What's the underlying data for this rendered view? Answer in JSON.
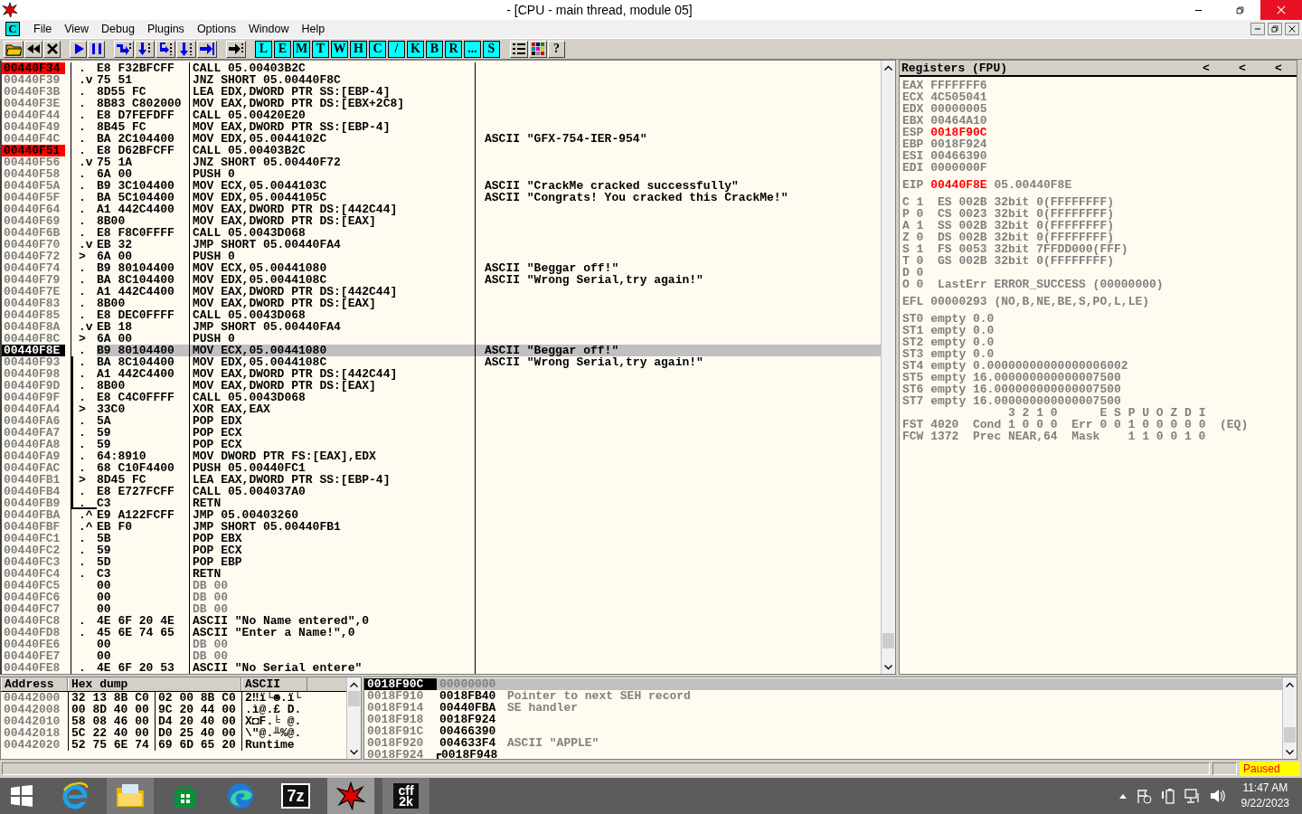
{
  "window": {
    "title": "- [CPU - main thread, module 05]"
  },
  "menu": {
    "badge": "C",
    "items": [
      "File",
      "View",
      "Debug",
      "Plugins",
      "Options",
      "Window",
      "Help"
    ]
  },
  "toolbar": [
    {
      "items": [
        {
          "kind": "open"
        },
        {
          "kind": "restart"
        },
        {
          "kind": "close"
        }
      ]
    },
    {
      "items": [
        {
          "kind": "run"
        },
        {
          "kind": "pause"
        }
      ]
    },
    {
      "items": [
        {
          "kind": "step-into"
        },
        {
          "kind": "step-over"
        },
        {
          "kind": "trace-into"
        },
        {
          "kind": "trace-over"
        },
        {
          "kind": "till-return"
        }
      ]
    },
    {
      "items": [
        {
          "kind": "goto"
        }
      ]
    },
    {
      "items": [
        {
          "kind": "window",
          "label": "L"
        },
        {
          "kind": "window",
          "label": "E"
        },
        {
          "kind": "window",
          "label": "M"
        },
        {
          "kind": "window",
          "label": "T"
        },
        {
          "kind": "window",
          "label": "W"
        },
        {
          "kind": "window",
          "label": "H"
        },
        {
          "kind": "window",
          "label": "C"
        },
        {
          "kind": "window",
          "label": "/"
        },
        {
          "kind": "window",
          "label": "K"
        },
        {
          "kind": "window",
          "label": "B"
        },
        {
          "kind": "window",
          "label": "R"
        },
        {
          "kind": "window",
          "label": "..."
        },
        {
          "kind": "window",
          "label": "S"
        }
      ]
    },
    {
      "items": [
        {
          "kind": "list"
        },
        {
          "kind": "colors"
        },
        {
          "kind": "help",
          "label": "?"
        }
      ]
    }
  ],
  "disassembly": {
    "rows": [
      {
        "address": "00440F34",
        "mark": ".",
        "hex": "E8 F32BFCFF",
        "command": "CALL 05.00403B2C",
        "breakpoint": true,
        "selected": false,
        "greyed": false,
        "bracketed": false
      },
      {
        "address": "00440F39",
        "mark": ".v",
        "hex": "75 51",
        "command": "JNZ SHORT 05.00440F8C",
        "breakpoint": false,
        "selected": false,
        "greyed": false,
        "bracketed": false
      },
      {
        "address": "00440F3B",
        "mark": ".",
        "hex": "8D55 FC",
        "command": "LEA EDX,DWORD PTR SS:[EBP-4]",
        "breakpoint": false,
        "selected": false,
        "greyed": false,
        "bracketed": false
      },
      {
        "address": "00440F3E",
        "mark": ".",
        "hex": "8B83 C802000",
        "command": "MOV EAX,DWORD PTR DS:[EBX+2C8]",
        "breakpoint": false,
        "selected": false,
        "greyed": false,
        "bracketed": false
      },
      {
        "address": "00440F44",
        "mark": ".",
        "hex": "E8 D7FEFDFF",
        "command": "CALL 05.00420E20",
        "breakpoint": false,
        "selected": false,
        "greyed": false,
        "bracketed": false
      },
      {
        "address": "00440F49",
        "mark": ".",
        "hex": "8B45 FC",
        "command": "MOV EAX,DWORD PTR SS:[EBP-4]",
        "breakpoint": false,
        "selected": false,
        "greyed": false,
        "bracketed": false
      },
      {
        "address": "00440F4C",
        "mark": ".",
        "hex": "BA 2C104400",
        "command": "MOV EDX,05.0044102C",
        "comment": "ASCII \"GFX-754-IER-954\"",
        "breakpoint": false,
        "selected": false,
        "greyed": false,
        "bracketed": false
      },
      {
        "address": "00440F51",
        "mark": ".",
        "hex": "E8 D62BFCFF",
        "command": "CALL 05.00403B2C",
        "breakpoint": true,
        "selected": false,
        "greyed": false,
        "bracketed": false
      },
      {
        "address": "00440F56",
        "mark": ".v",
        "hex": "75 1A",
        "command": "JNZ SHORT 05.00440F72",
        "breakpoint": false,
        "selected": false,
        "greyed": false,
        "bracketed": false
      },
      {
        "address": "00440F58",
        "mark": ".",
        "hex": "6A 00",
        "command": "PUSH 0",
        "breakpoint": false,
        "selected": false,
        "greyed": false,
        "bracketed": false
      },
      {
        "address": "00440F5A",
        "mark": ".",
        "hex": "B9 3C104400",
        "command": "MOV ECX,05.0044103C",
        "comment": "ASCII \"CrackMe cracked successfully\"",
        "breakpoint": false,
        "selected": false,
        "greyed": false,
        "bracketed": false
      },
      {
        "address": "00440F5F",
        "mark": ".",
        "hex": "BA 5C104400",
        "command": "MOV EDX,05.0044105C",
        "comment": "ASCII \"Congrats! You cracked this CrackMe!\"",
        "breakpoint": false,
        "selected": false,
        "greyed": false,
        "bracketed": false
      },
      {
        "address": "00440F64",
        "mark": ".",
        "hex": "A1 442C4400",
        "command": "MOV EAX,DWORD PTR DS:[442C44]",
        "breakpoint": false,
        "selected": false,
        "greyed": false,
        "bracketed": false
      },
      {
        "address": "00440F69",
        "mark": ".",
        "hex": "8B00",
        "command": "MOV EAX,DWORD PTR DS:[EAX]",
        "breakpoint": false,
        "selected": false,
        "greyed": false,
        "bracketed": false
      },
      {
        "address": "00440F6B",
        "mark": ".",
        "hex": "E8 F8C0FFFF",
        "command": "CALL 05.0043D068",
        "breakpoint": false,
        "selected": false,
        "greyed": false,
        "bracketed": false
      },
      {
        "address": "00440F70",
        "mark": ".v",
        "hex": "EB 32",
        "command": "JMP SHORT 05.00440FA4",
        "breakpoint": false,
        "selected": false,
        "greyed": false,
        "bracketed": false
      },
      {
        "address": "00440F72",
        "mark": ">",
        "hex": "6A 00",
        "command": "PUSH 0",
        "breakpoint": false,
        "selected": false,
        "greyed": false,
        "bracketed": false
      },
      {
        "address": "00440F74",
        "mark": ".",
        "hex": "B9 80104400",
        "command": "MOV ECX,05.00441080",
        "comment": "ASCII \"Beggar off!\"",
        "breakpoint": false,
        "selected": false,
        "greyed": false,
        "bracketed": false
      },
      {
        "address": "00440F79",
        "mark": ".",
        "hex": "BA 8C104400",
        "command": "MOV EDX,05.0044108C",
        "comment": "ASCII \"Wrong Serial,try again!\"",
        "breakpoint": false,
        "selected": false,
        "greyed": false,
        "bracketed": false
      },
      {
        "address": "00440F7E",
        "mark": ".",
        "hex": "A1 442C4400",
        "command": "MOV EAX,DWORD PTR DS:[442C44]",
        "breakpoint": false,
        "selected": false,
        "greyed": false,
        "bracketed": false
      },
      {
        "address": "00440F83",
        "mark": ".",
        "hex": "8B00",
        "command": "MOV EAX,DWORD PTR DS:[EAX]",
        "breakpoint": false,
        "selected": false,
        "greyed": false,
        "bracketed": false
      },
      {
        "address": "00440F85",
        "mark": ".",
        "hex": "E8 DEC0FFFF",
        "command": "CALL 05.0043D068",
        "breakpoint": false,
        "selected": false,
        "greyed": false,
        "bracketed": false
      },
      {
        "address": "00440F8A",
        "mark": ".v",
        "hex": "EB 18",
        "command": "JMP SHORT 05.00440FA4",
        "breakpoint": false,
        "selected": false,
        "greyed": false,
        "bracketed": false
      },
      {
        "address": "00440F8C",
        "mark": ">",
        "hex": "6A 00",
        "command": "PUSH 0",
        "breakpoint": false,
        "selected": false,
        "greyed": false,
        "bracketed": false
      },
      {
        "address": "00440F8E",
        "mark": ".",
        "hex": "B9 80104400",
        "command": "MOV ECX,05.00441080",
        "comment": "ASCII \"Beggar off!\"",
        "breakpoint": false,
        "selected": true,
        "greyed": false,
        "bracketed": false
      },
      {
        "address": "00440F93",
        "mark": ".",
        "hex": "BA 8C104400",
        "command": "MOV EDX,05.0044108C",
        "comment": "ASCII \"Wrong Serial,try again!\"",
        "breakpoint": false,
        "selected": false,
        "greyed": false,
        "bracketed": true
      },
      {
        "address": "00440F98",
        "mark": ".",
        "hex": "A1 442C4400",
        "command": "MOV EAX,DWORD PTR DS:[442C44]",
        "breakpoint": false,
        "selected": false,
        "greyed": false,
        "bracketed": true
      },
      {
        "address": "00440F9D",
        "mark": ".",
        "hex": "8B00",
        "command": "MOV EAX,DWORD PTR DS:[EAX]",
        "breakpoint": false,
        "selected": false,
        "greyed": false,
        "bracketed": true
      },
      {
        "address": "00440F9F",
        "mark": ".",
        "hex": "E8 C4C0FFFF",
        "command": "CALL 05.0043D068",
        "breakpoint": false,
        "selected": false,
        "greyed": false,
        "bracketed": true
      },
      {
        "address": "00440FA4",
        "mark": ">",
        "hex": "33C0",
        "command": "XOR EAX,EAX",
        "breakpoint": false,
        "selected": false,
        "greyed": false,
        "bracketed": true
      },
      {
        "address": "00440FA6",
        "mark": ".",
        "hex": "5A",
        "command": "POP EDX",
        "breakpoint": false,
        "selected": false,
        "greyed": false,
        "bracketed": true
      },
      {
        "address": "00440FA7",
        "mark": ".",
        "hex": "59",
        "command": "POP ECX",
        "breakpoint": false,
        "selected": false,
        "greyed": false,
        "bracketed": true
      },
      {
        "address": "00440FA8",
        "mark": ".",
        "hex": "59",
        "command": "POP ECX",
        "breakpoint": false,
        "selected": false,
        "greyed": false,
        "bracketed": true
      },
      {
        "address": "00440FA9",
        "mark": ".",
        "hex": "64:8910",
        "command": "MOV DWORD PTR FS:[EAX],EDX",
        "breakpoint": false,
        "selected": false,
        "greyed": false,
        "bracketed": true
      },
      {
        "address": "00440FAC",
        "mark": ".",
        "hex": "68 C10F4400",
        "command": "PUSH 05.00440FC1",
        "breakpoint": false,
        "selected": false,
        "greyed": false,
        "bracketed": true
      },
      {
        "address": "00440FB1",
        "mark": ">",
        "hex": "8D45 FC",
        "command": "LEA EAX,DWORD PTR SS:[EBP-4]",
        "breakpoint": false,
        "selected": false,
        "greyed": false,
        "bracketed": true
      },
      {
        "address": "00440FB4",
        "mark": ".",
        "hex": "E8 E727FCFF",
        "command": "CALL 05.004037A0",
        "breakpoint": false,
        "selected": false,
        "greyed": false,
        "bracketed": true
      },
      {
        "address": "00440FB9",
        "mark": ".",
        "hex": "C3",
        "command": "RETN",
        "breakpoint": false,
        "selected": false,
        "greyed": false,
        "bracketed": true
      },
      {
        "address": "00440FBA",
        "mark": ".^",
        "hex": "E9 A122FCFF",
        "command": "JMP 05.00403260",
        "breakpoint": false,
        "selected": false,
        "greyed": false,
        "bracketed": false
      },
      {
        "address": "00440FBF",
        "mark": ".^",
        "hex": "EB F0",
        "command": "JMP SHORT 05.00440FB1",
        "breakpoint": false,
        "selected": false,
        "greyed": false,
        "bracketed": false
      },
      {
        "address": "00440FC1",
        "mark": ".",
        "hex": "5B",
        "command": "POP EBX",
        "breakpoint": false,
        "selected": false,
        "greyed": false,
        "bracketed": false
      },
      {
        "address": "00440FC2",
        "mark": ".",
        "hex": "59",
        "command": "POP ECX",
        "breakpoint": false,
        "selected": false,
        "greyed": false,
        "bracketed": false
      },
      {
        "address": "00440FC3",
        "mark": ".",
        "hex": "5D",
        "command": "POP EBP",
        "breakpoint": false,
        "selected": false,
        "greyed": false,
        "bracketed": false
      },
      {
        "address": "00440FC4",
        "mark": ".",
        "hex": "C3",
        "command": "RETN",
        "breakpoint": false,
        "selected": false,
        "greyed": false,
        "bracketed": false
      },
      {
        "address": "00440FC5",
        "hex": "00",
        "command": "DB 00",
        "breakpoint": false,
        "selected": false,
        "greyed": true,
        "bracketed": false
      },
      {
        "address": "00440FC6",
        "hex": "00",
        "command": "DB 00",
        "breakpoint": false,
        "selected": false,
        "greyed": true,
        "bracketed": false
      },
      {
        "address": "00440FC7",
        "hex": "00",
        "command": "DB 00",
        "breakpoint": false,
        "selected": false,
        "greyed": true,
        "bracketed": false
      },
      {
        "address": "00440FC8",
        "mark": ".",
        "hex": "4E 6F 20 4E",
        "command": "ASCII \"No Name entered\",0",
        "breakpoint": false,
        "selected": false,
        "greyed": false,
        "bracketed": false
      },
      {
        "address": "00440FD8",
        "mark": ".",
        "hex": "45 6E 74 65",
        "command": "ASCII \"Enter a Name!\",0",
        "breakpoint": false,
        "selected": false,
        "greyed": false,
        "bracketed": false
      },
      {
        "address": "00440FE6",
        "hex": "00",
        "command": "DB 00",
        "breakpoint": false,
        "selected": false,
        "greyed": true,
        "bracketed": false
      },
      {
        "address": "00440FE7",
        "hex": "00",
        "command": "DB 00",
        "breakpoint": false,
        "selected": false,
        "greyed": true,
        "bracketed": false
      },
      {
        "address": "00440FE8",
        "mark": ".",
        "hex": "4E 6F 20 53",
        "command": "ASCII \"No Serial entere\"",
        "breakpoint": false,
        "selected": false,
        "greyed": false,
        "bracketed": false
      }
    ]
  },
  "registers": {
    "title": "Registers (FPU)",
    "arrows": [
      "<",
      "<",
      "<"
    ],
    "general": [
      {
        "name": "EAX",
        "value": "FFFFFFF6",
        "changed": false
      },
      {
        "name": "ECX",
        "value": "4C505041",
        "changed": false
      },
      {
        "name": "EDX",
        "value": "00000005",
        "changed": false
      },
      {
        "name": "EBX",
        "value": "00464A10",
        "changed": false
      },
      {
        "name": "ESP",
        "value": "0018F90C",
        "changed": true
      },
      {
        "name": "EBP",
        "value": "0018F924",
        "changed": false
      },
      {
        "name": "ESI",
        "value": "00466390",
        "changed": false
      },
      {
        "name": "EDI",
        "value": "0000000F",
        "changed": false
      }
    ],
    "eip": {
      "name": "EIP",
      "value": "00440F8E",
      "changed": true,
      "note": "05.00440F8E"
    },
    "flags": [
      {
        "flag": "C",
        "value": "1",
        "detail": "ES 002B 32bit 0(FFFFFFFF)"
      },
      {
        "flag": "P",
        "value": "0",
        "detail": "CS 0023 32bit 0(FFFFFFFF)"
      },
      {
        "flag": "A",
        "value": "1",
        "detail": "SS 002B 32bit 0(FFFFFFFF)"
      },
      {
        "flag": "Z",
        "value": "0",
        "detail": "DS 002B 32bit 0(FFFFFFFF)"
      },
      {
        "flag": "S",
        "value": "1",
        "detail": "FS 0053 32bit 7FFDD000(FFF)"
      },
      {
        "flag": "T",
        "value": "0",
        "detail": "GS 002B 32bit 0(FFFFFFFF)"
      },
      {
        "flag": "D",
        "value": "0"
      },
      {
        "flag": "O",
        "value": "0",
        "detail": "LastErr ERROR_SUCCESS (00000000)"
      }
    ],
    "efl": {
      "name": "EFL",
      "value": "00000293",
      "note": "(NO,B,NE,BE,S,PO,L,LE)"
    },
    "fpu": [
      {
        "name": "ST0",
        "tag": "empty",
        "value": "0.0"
      },
      {
        "name": "ST1",
        "tag": "empty",
        "value": "0.0"
      },
      {
        "name": "ST2",
        "tag": "empty",
        "value": "0.0"
      },
      {
        "name": "ST3",
        "tag": "empty",
        "value": "0.0"
      },
      {
        "name": "ST4",
        "tag": "empty",
        "value": "0.00000000000000006002"
      },
      {
        "name": "ST5",
        "tag": "empty",
        "value": "16.000000000000007500"
      },
      {
        "name": "ST6",
        "tag": "empty",
        "value": "16.000000000000007500"
      },
      {
        "name": "ST7",
        "tag": "empty",
        "value": "16.000000000000007500"
      }
    ],
    "bit_headers": [
      "3 2 1 0",
      "E S P U O Z D I"
    ],
    "fst": {
      "name": "FST",
      "value": "4020",
      "cond": "Cond 1 0 0 0",
      "err": "Err 0 0 1 0 0 0 0 0",
      "note": "(EQ)"
    },
    "fcw": {
      "name": "FCW",
      "value": "1372",
      "prec": "Prec NEAR,64",
      "mask": "Mask",
      "mask_bits": "1 1 0 0 1 0"
    }
  },
  "dump": {
    "columns": [
      "Address",
      "Hex dump",
      "ASCII"
    ],
    "rows": [
      {
        "address": "00442000",
        "hex": [
          "32 13 8B C0",
          "02 00 8B C0"
        ],
        "ascii": "2‼ï└☻.ï└"
      },
      {
        "address": "00442008",
        "hex": [
          "00 8D 40 00",
          "9C 20 44 00"
        ],
        "ascii": ".ì@.£ D."
      },
      {
        "address": "00442010",
        "hex": [
          "58 08 46 00",
          "D4 20 40 00"
        ],
        "ascii": "X◘F.╘ @."
      },
      {
        "address": "00442018",
        "hex": [
          "5C 22 40 00",
          "D0 25 40 00"
        ],
        "ascii": "\\\"@.╨%@."
      },
      {
        "address": "00442020",
        "hex": [
          "52 75 6E 74",
          "69 6D 65 20"
        ],
        "ascii": "Runtime "
      }
    ]
  },
  "stack": {
    "rows": [
      {
        "address": "0018F90C",
        "value": "00000000",
        "selected": true,
        "frame_start": false
      },
      {
        "address": "0018F910",
        "value": "0018FB40",
        "comment": "Pointer to next SEH record",
        "selected": false,
        "frame_start": false
      },
      {
        "address": "0018F914",
        "value": "00440FBA",
        "comment": "SE handler",
        "selected": false,
        "frame_start": false
      },
      {
        "address": "0018F918",
        "value": "0018F924",
        "selected": false,
        "frame_start": false
      },
      {
        "address": "0018F91C",
        "value": "00466390",
        "selected": false,
        "frame_start": false
      },
      {
        "address": "0018F920",
        "value": "004633F4",
        "comment": "ASCII \"APPLE\"",
        "selected": false,
        "frame_start": false
      },
      {
        "address": "0018F924",
        "value": "0018F948",
        "selected": false,
        "frame_start": true
      }
    ]
  },
  "status_bar": {
    "state": "Paused"
  },
  "taskbar": {
    "apps": [
      {
        "kind": "start",
        "selected": false,
        "running": false
      },
      {
        "kind": "ie",
        "selected": false,
        "running": false
      },
      {
        "kind": "explorer",
        "selected": false,
        "running": true
      },
      {
        "kind": "store",
        "selected": false,
        "running": false
      },
      {
        "kind": "edge",
        "selected": false,
        "running": false
      },
      {
        "kind": "archiver",
        "logo_text": [
          "7z"
        ],
        "selected": false,
        "running": false
      },
      {
        "kind": "ollydbg",
        "selected": true,
        "running": true
      },
      {
        "kind": "cff",
        "logo_text": [
          "cff",
          "2k"
        ],
        "selected": false,
        "running": true
      }
    ],
    "tray": [
      {
        "kind": "chevron"
      },
      {
        "kind": "flag"
      },
      {
        "kind": "battery"
      },
      {
        "kind": "network"
      },
      {
        "kind": "volume"
      }
    ],
    "time": "11:47 AM",
    "date": "9/22/2023"
  }
}
